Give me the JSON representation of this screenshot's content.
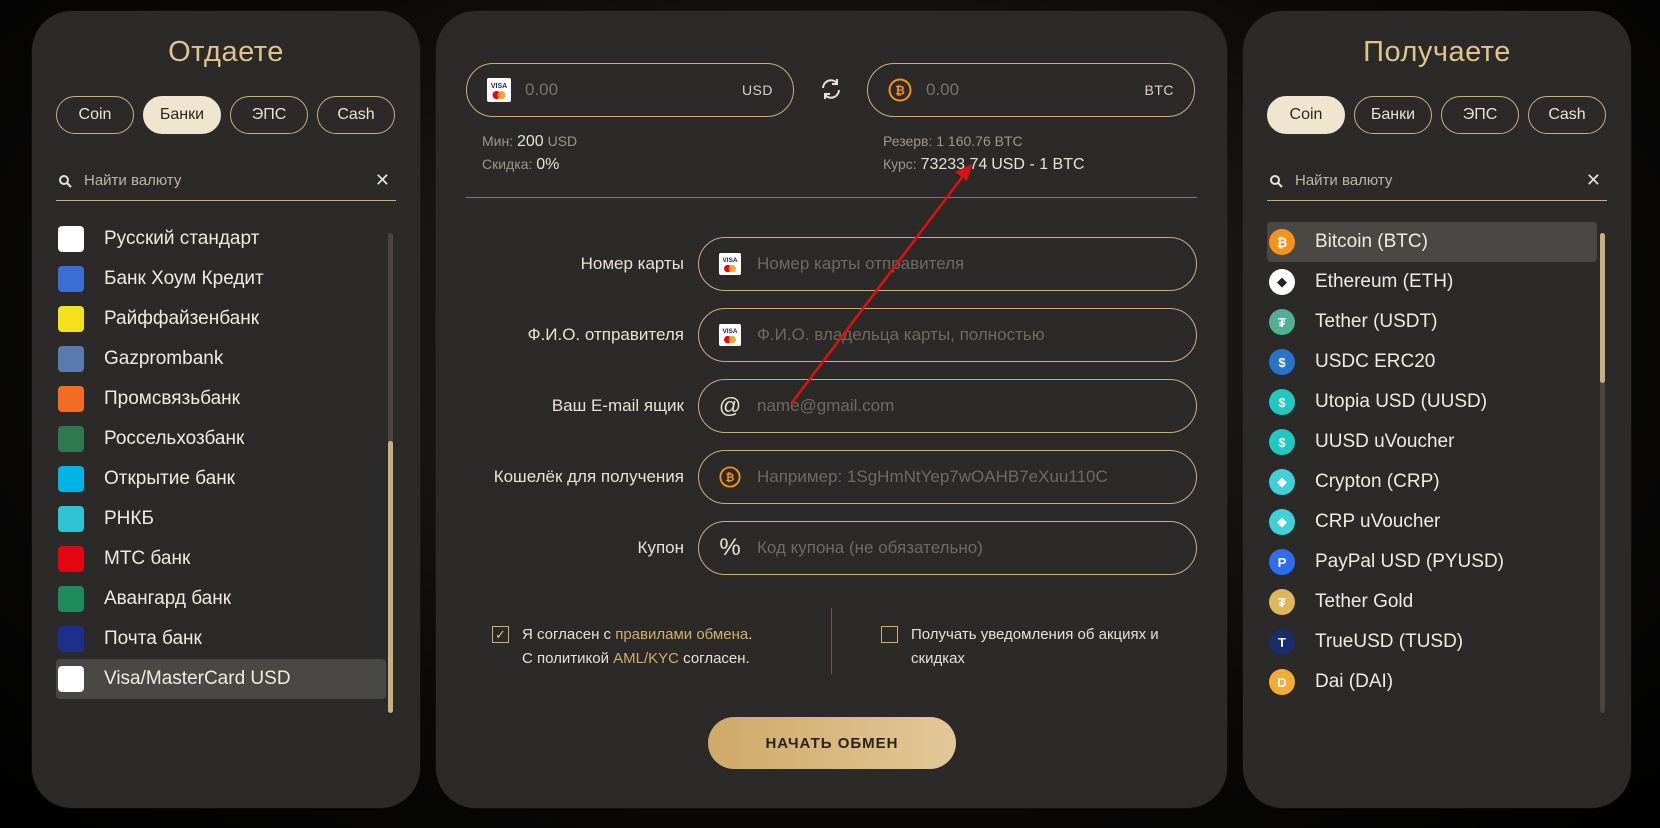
{
  "left": {
    "title": "Отдаете",
    "tabs": [
      "Coin",
      "Банки",
      "ЭПС",
      "Cash"
    ],
    "search_placeholder": "Найти валюту",
    "items": [
      {
        "label": "Русский стандарт",
        "icon": "russian-standard-icon",
        "color": "#ffffff"
      },
      {
        "label": "Банк Хоум Кредит",
        "icon": "home-credit-icon",
        "color": "#3b6fd6"
      },
      {
        "label": "Райффайзенбанк",
        "icon": "raiffeisen-icon",
        "color": "#f5e11a"
      },
      {
        "label": "Gazprombank",
        "icon": "gazprombank-icon",
        "color": "#5a7bb0"
      },
      {
        "label": "Промсвязьбанк",
        "icon": "psb-icon",
        "color": "#f26d21"
      },
      {
        "label": "Россельхозбанк",
        "icon": "rshb-icon",
        "color": "#2e7a4e"
      },
      {
        "label": "Открытие банк",
        "icon": "otkritie-icon",
        "color": "#00b4e6"
      },
      {
        "label": "РНКБ",
        "icon": "rnkb-icon",
        "color": "#2ec4d6"
      },
      {
        "label": "МТС банк",
        "icon": "mts-icon",
        "color": "#e30611"
      },
      {
        "label": "Авангард банк",
        "icon": "avangard-icon",
        "color": "#1f8a5b"
      },
      {
        "label": "Почта банк",
        "icon": "pochta-icon",
        "color": "#1c2f8a"
      },
      {
        "label": "Visa/MasterCard USD",
        "icon": "visa-mastercard-icon",
        "color": "#ffffff"
      }
    ]
  },
  "right": {
    "title": "Получаете",
    "tabs": [
      "Coin",
      "Банки",
      "ЭПС",
      "Cash"
    ],
    "search_placeholder": "Найти валюту",
    "items": [
      {
        "label": "Bitcoin (BTC)",
        "icon": "bitcoin-icon",
        "color": "#f7931a",
        "glyph": "₿"
      },
      {
        "label": "Ethereum (ETH)",
        "icon": "ethereum-icon",
        "color": "#ffffff",
        "glyph": "◆"
      },
      {
        "label": "Tether (USDT)",
        "icon": "tether-icon",
        "color": "#50af95",
        "glyph": "₮"
      },
      {
        "label": "USDC ERC20",
        "icon": "usdc-icon",
        "color": "#2775ca",
        "glyph": "$"
      },
      {
        "label": "Utopia USD (UUSD)",
        "icon": "utopia-usd-icon",
        "color": "#1fc9c1",
        "glyph": "$"
      },
      {
        "label": "UUSD uVoucher",
        "icon": "uusd-voucher-icon",
        "color": "#1fc9c1",
        "glyph": "$"
      },
      {
        "label": "Crypton (CRP)",
        "icon": "crypton-icon",
        "color": "#3fd0d8",
        "glyph": "◆"
      },
      {
        "label": "CRP uVoucher",
        "icon": "crp-voucher-icon",
        "color": "#3fd0d8",
        "glyph": "◆"
      },
      {
        "label": "PayPal USD (PYUSD)",
        "icon": "paypal-usd-icon",
        "color": "#2f6df0",
        "glyph": "P"
      },
      {
        "label": "Tether Gold",
        "icon": "tether-gold-icon",
        "color": "#e0b65a",
        "glyph": "₮"
      },
      {
        "label": "TrueUSD (TUSD)",
        "icon": "trueusd-icon",
        "color": "#1a2c6b",
        "glyph": "T"
      },
      {
        "label": "Dai (DAI)",
        "icon": "dai-icon",
        "color": "#f5ac37",
        "glyph": "D"
      }
    ]
  },
  "exchange": {
    "give_value": "0.00",
    "give_currency": "USD",
    "get_value": "0.00",
    "get_currency": "BTC",
    "min_label": "Мин:",
    "min_value": "200",
    "min_currency": "USD",
    "discount_label": "Скидка:",
    "discount_value": "0%",
    "reserve_text": "Резерв: 1 160.76 BTC",
    "rate_label": "Курс:",
    "rate_value": "73233.74",
    "rate_suffix": "USD - 1 BTC"
  },
  "form": {
    "card_label": "Номер карты",
    "card_placeholder": "Номер карты отправителя",
    "name_label": "Ф.И.О. отправителя",
    "name_placeholder": "Ф.И.О. владельца карты, полностью",
    "email_label": "Ваш E-mail ящик",
    "email_placeholder": "name@gmail.com",
    "wallet_label": "Кошелёк для получения",
    "wallet_placeholder": "Например: 1SgHmNtYep7wOAHB7eXuu110C",
    "coupon_label": "Купон",
    "coupon_placeholder": "Код купона (не обязательно)"
  },
  "agreements": {
    "agree_prefix": "Я согласен с ",
    "agree_link": "правилами обмена",
    "agree_suffix": ".",
    "policy_prefix": "С политикой ",
    "policy_link": "AML/KYC",
    "policy_suffix": " согласен.",
    "agree_checked": true,
    "notify_text": "Получать уведомления об акциях и скидках",
    "notify_checked": false
  },
  "start_button": "НАЧАТЬ ОБМЕН",
  "colors": {
    "accent": "#c9b07a",
    "gold_text": "#e0c48c",
    "panel": "#2b2a28",
    "annotation_arrow": "#e01010"
  }
}
